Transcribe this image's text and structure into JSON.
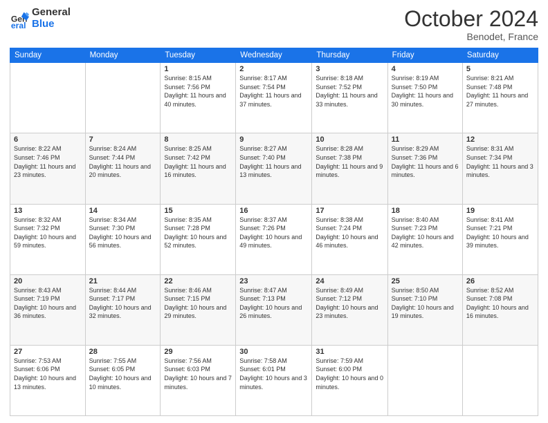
{
  "logo": {
    "general": "General",
    "blue": "Blue"
  },
  "header": {
    "month": "October 2024",
    "location": "Benodet, France"
  },
  "days_of_week": [
    "Sunday",
    "Monday",
    "Tuesday",
    "Wednesday",
    "Thursday",
    "Friday",
    "Saturday"
  ],
  "weeks": [
    [
      {
        "day": "",
        "sunrise": "",
        "sunset": "",
        "daylight": ""
      },
      {
        "day": "",
        "sunrise": "",
        "sunset": "",
        "daylight": ""
      },
      {
        "day": "1",
        "sunrise": "Sunrise: 8:15 AM",
        "sunset": "Sunset: 7:56 PM",
        "daylight": "Daylight: 11 hours and 40 minutes."
      },
      {
        "day": "2",
        "sunrise": "Sunrise: 8:17 AM",
        "sunset": "Sunset: 7:54 PM",
        "daylight": "Daylight: 11 hours and 37 minutes."
      },
      {
        "day": "3",
        "sunrise": "Sunrise: 8:18 AM",
        "sunset": "Sunset: 7:52 PM",
        "daylight": "Daylight: 11 hours and 33 minutes."
      },
      {
        "day": "4",
        "sunrise": "Sunrise: 8:19 AM",
        "sunset": "Sunset: 7:50 PM",
        "daylight": "Daylight: 11 hours and 30 minutes."
      },
      {
        "day": "5",
        "sunrise": "Sunrise: 8:21 AM",
        "sunset": "Sunset: 7:48 PM",
        "daylight": "Daylight: 11 hours and 27 minutes."
      }
    ],
    [
      {
        "day": "6",
        "sunrise": "Sunrise: 8:22 AM",
        "sunset": "Sunset: 7:46 PM",
        "daylight": "Daylight: 11 hours and 23 minutes."
      },
      {
        "day": "7",
        "sunrise": "Sunrise: 8:24 AM",
        "sunset": "Sunset: 7:44 PM",
        "daylight": "Daylight: 11 hours and 20 minutes."
      },
      {
        "day": "8",
        "sunrise": "Sunrise: 8:25 AM",
        "sunset": "Sunset: 7:42 PM",
        "daylight": "Daylight: 11 hours and 16 minutes."
      },
      {
        "day": "9",
        "sunrise": "Sunrise: 8:27 AM",
        "sunset": "Sunset: 7:40 PM",
        "daylight": "Daylight: 11 hours and 13 minutes."
      },
      {
        "day": "10",
        "sunrise": "Sunrise: 8:28 AM",
        "sunset": "Sunset: 7:38 PM",
        "daylight": "Daylight: 11 hours and 9 minutes."
      },
      {
        "day": "11",
        "sunrise": "Sunrise: 8:29 AM",
        "sunset": "Sunset: 7:36 PM",
        "daylight": "Daylight: 11 hours and 6 minutes."
      },
      {
        "day": "12",
        "sunrise": "Sunrise: 8:31 AM",
        "sunset": "Sunset: 7:34 PM",
        "daylight": "Daylight: 11 hours and 3 minutes."
      }
    ],
    [
      {
        "day": "13",
        "sunrise": "Sunrise: 8:32 AM",
        "sunset": "Sunset: 7:32 PM",
        "daylight": "Daylight: 10 hours and 59 minutes."
      },
      {
        "day": "14",
        "sunrise": "Sunrise: 8:34 AM",
        "sunset": "Sunset: 7:30 PM",
        "daylight": "Daylight: 10 hours and 56 minutes."
      },
      {
        "day": "15",
        "sunrise": "Sunrise: 8:35 AM",
        "sunset": "Sunset: 7:28 PM",
        "daylight": "Daylight: 10 hours and 52 minutes."
      },
      {
        "day": "16",
        "sunrise": "Sunrise: 8:37 AM",
        "sunset": "Sunset: 7:26 PM",
        "daylight": "Daylight: 10 hours and 49 minutes."
      },
      {
        "day": "17",
        "sunrise": "Sunrise: 8:38 AM",
        "sunset": "Sunset: 7:24 PM",
        "daylight": "Daylight: 10 hours and 46 minutes."
      },
      {
        "day": "18",
        "sunrise": "Sunrise: 8:40 AM",
        "sunset": "Sunset: 7:23 PM",
        "daylight": "Daylight: 10 hours and 42 minutes."
      },
      {
        "day": "19",
        "sunrise": "Sunrise: 8:41 AM",
        "sunset": "Sunset: 7:21 PM",
        "daylight": "Daylight: 10 hours and 39 minutes."
      }
    ],
    [
      {
        "day": "20",
        "sunrise": "Sunrise: 8:43 AM",
        "sunset": "Sunset: 7:19 PM",
        "daylight": "Daylight: 10 hours and 36 minutes."
      },
      {
        "day": "21",
        "sunrise": "Sunrise: 8:44 AM",
        "sunset": "Sunset: 7:17 PM",
        "daylight": "Daylight: 10 hours and 32 minutes."
      },
      {
        "day": "22",
        "sunrise": "Sunrise: 8:46 AM",
        "sunset": "Sunset: 7:15 PM",
        "daylight": "Daylight: 10 hours and 29 minutes."
      },
      {
        "day": "23",
        "sunrise": "Sunrise: 8:47 AM",
        "sunset": "Sunset: 7:13 PM",
        "daylight": "Daylight: 10 hours and 26 minutes."
      },
      {
        "day": "24",
        "sunrise": "Sunrise: 8:49 AM",
        "sunset": "Sunset: 7:12 PM",
        "daylight": "Daylight: 10 hours and 23 minutes."
      },
      {
        "day": "25",
        "sunrise": "Sunrise: 8:50 AM",
        "sunset": "Sunset: 7:10 PM",
        "daylight": "Daylight: 10 hours and 19 minutes."
      },
      {
        "day": "26",
        "sunrise": "Sunrise: 8:52 AM",
        "sunset": "Sunset: 7:08 PM",
        "daylight": "Daylight: 10 hours and 16 minutes."
      }
    ],
    [
      {
        "day": "27",
        "sunrise": "Sunrise: 7:53 AM",
        "sunset": "Sunset: 6:06 PM",
        "daylight": "Daylight: 10 hours and 13 minutes."
      },
      {
        "day": "28",
        "sunrise": "Sunrise: 7:55 AM",
        "sunset": "Sunset: 6:05 PM",
        "daylight": "Daylight: 10 hours and 10 minutes."
      },
      {
        "day": "29",
        "sunrise": "Sunrise: 7:56 AM",
        "sunset": "Sunset: 6:03 PM",
        "daylight": "Daylight: 10 hours and 7 minutes."
      },
      {
        "day": "30",
        "sunrise": "Sunrise: 7:58 AM",
        "sunset": "Sunset: 6:01 PM",
        "daylight": "Daylight: 10 hours and 3 minutes."
      },
      {
        "day": "31",
        "sunrise": "Sunrise: 7:59 AM",
        "sunset": "Sunset: 6:00 PM",
        "daylight": "Daylight: 10 hours and 0 minutes."
      },
      {
        "day": "",
        "sunrise": "",
        "sunset": "",
        "daylight": ""
      },
      {
        "day": "",
        "sunrise": "",
        "sunset": "",
        "daylight": ""
      }
    ]
  ]
}
